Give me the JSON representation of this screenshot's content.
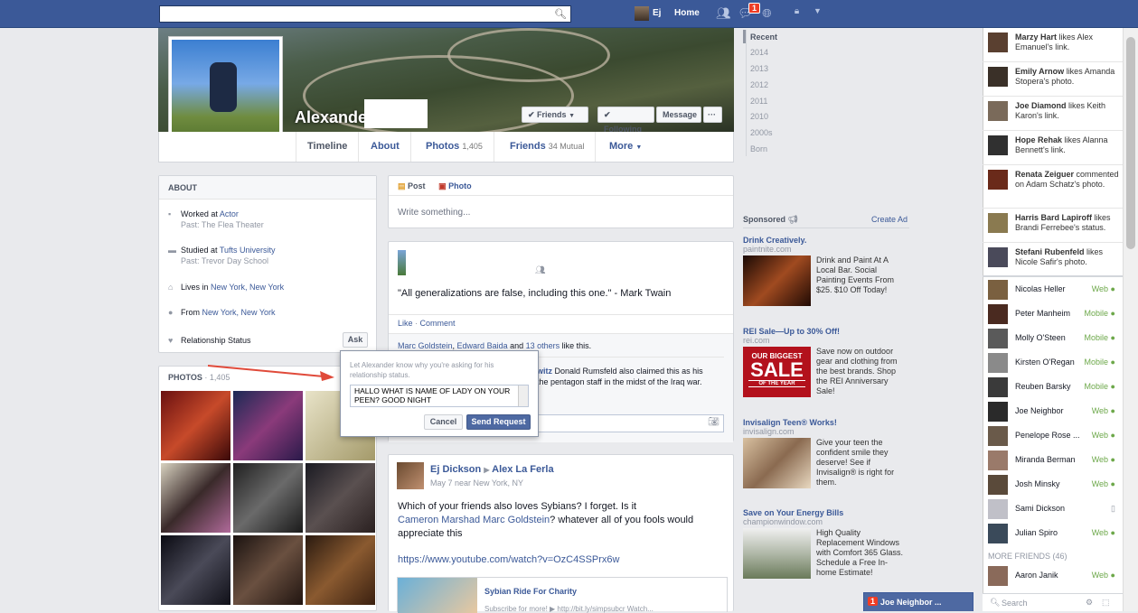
{
  "topbar": {
    "user_name": "Ej",
    "home_label": "Home",
    "notification_count": "1"
  },
  "profile": {
    "name": "Alexande",
    "friends_btn": "Friends",
    "following_btn": "Following",
    "message_btn": "Message",
    "more_btn": "···"
  },
  "tabs": {
    "timeline": "Timeline",
    "about": "About",
    "photos": "Photos",
    "photos_count": "1,405",
    "friends": "Friends",
    "friends_count": "34 Mutual",
    "more": "More"
  },
  "about": {
    "header": "ABOUT",
    "work_prefix": "Worked at ",
    "work_link": "Actor",
    "work_sub": "Past: The Flea Theater",
    "study_prefix": "Studied at ",
    "study_link": "Tufts University",
    "study_sub": "Past: Trevor Day School",
    "lives_prefix": "Lives in ",
    "lives_link": "New York, New York",
    "from_prefix": "From ",
    "from_link": "New York, New York",
    "relationship": "Relationship Status",
    "ask_btn": "Ask"
  },
  "photos_box": {
    "header": "PHOTOS",
    "count": "1,405"
  },
  "popup": {
    "prompt": "Let Alexander know why you're asking for his relationship status.",
    "text": "HALLO WHAT IS NAME OF LADY ON YOUR PEEN? GOOD NIGHT",
    "cancel": "Cancel",
    "send": "Send Request"
  },
  "composer": {
    "post_tab": "Post",
    "photo_tab": "Photo",
    "placeholder": "Write something..."
  },
  "post1": {
    "quote": "\"All generalizations are false, including this one.\" - Mark Twain",
    "like": "Like",
    "comment": "Comment",
    "likers_a": "Marc Goldstein",
    "likers_b": "Edward Baida",
    "likers_and": " and ",
    "likers_others": "13 others",
    "likers_suffix": " like this.",
    "comment_name": "witz",
    "comment_text": "Donald Rumsfeld also claimed this as his",
    "comment_text2": "the pentagon staff in the midst of the Iraq war."
  },
  "post2": {
    "author": "Ej Dickson",
    "target": "Alex La Ferla",
    "meta": "May 7 near New York, NY",
    "text1": "Which of your friends also loves Sybians? I forget. Is it",
    "name1": "Cameron Marshad",
    "name2": "Marc Goldstein",
    "text2": "? whatever all of you fools would",
    "text3": "appreciate this",
    "url": "https://www.youtube.com/watch?v=OzC4SSPrx6w",
    "link_title": "Sybian Ride For Charity",
    "link_sub": "Subscribe for more! ▶ http://bit.ly/simpsubcr Watch..."
  },
  "timeline_nav": [
    "Recent",
    "2014",
    "2013",
    "2012",
    "2011",
    "2010",
    "2000s",
    "Born"
  ],
  "sponsored": {
    "label": "Sponsored",
    "create_ad": "Create Ad",
    "ads": [
      {
        "title": "Drink Creatively.",
        "url": "paintnite.com",
        "desc": "Drink and Paint At A Local Bar. Social Painting Events From $25. $10 Off Today!"
      },
      {
        "title": "REI Sale—Up to 30% Off!",
        "url": "rei.com",
        "desc": "Save now on outdoor gear and clothing from the best brands. Shop the REI Anniversary Sale!",
        "img_text1": "OUR BIGGEST",
        "img_text2": "SALE",
        "img_text3": "OF THE YEAR"
      },
      {
        "title": "Invisalign Teen® Works!",
        "url": "invisalign.com",
        "desc": "Give your teen the confident smile they deserve! See if Invisalign® is right for them."
      },
      {
        "title": "Save on Your Energy Bills",
        "url": "championwindow.com",
        "desc": "High Quality Replacement Windows with Comfort 365 Glass. Schedule a Free In-home Estimate!"
      }
    ]
  },
  "ticker": [
    {
      "name": "Marzy Hart",
      "rest": " likes Alex Emanuel's link."
    },
    {
      "name": "Emily Arnow",
      "rest": " likes Amanda Stopera's photo."
    },
    {
      "name": "Joe Diamond",
      "rest": " likes Keith Karon's link."
    },
    {
      "name": "Hope Rehak",
      "rest": " likes Alanna Bennett's link."
    },
    {
      "name": "Renata Zeiguer",
      "rest": " commented on Adam Schatz's photo."
    },
    {
      "name": "Harris Bard Lapiroff",
      "rest": " likes Brandi Ferrebee's status."
    },
    {
      "name": "Stefani Rubenfeld",
      "rest": " likes Nicole Safir's photo."
    }
  ],
  "chat": [
    {
      "name": "Nicolas Heller",
      "status": "Web ●"
    },
    {
      "name": "Peter Manheim",
      "status": "Mobile ●"
    },
    {
      "name": "Molly O'Steen",
      "status": "Mobile ●"
    },
    {
      "name": "Kirsten O'Regan",
      "status": "Mobile ●"
    },
    {
      "name": "Reuben Barsky",
      "status": "Mobile ●"
    },
    {
      "name": "Joe Neighbor",
      "status": "Web ●"
    },
    {
      "name": "Penelope Rose ...",
      "status": "Web ●"
    },
    {
      "name": "Miranda Berman",
      "status": "Web ●"
    },
    {
      "name": "Josh Minsky",
      "status": "Web ●"
    },
    {
      "name": "Sami Dickson",
      "status": "▯"
    },
    {
      "name": "Julian Spiro",
      "status": "Web ●"
    }
  ],
  "more_friends": "MORE FRIENDS (46)",
  "chat_more": {
    "name": "Aaron Janik",
    "status": "Web ●"
  },
  "chat_search": "Search",
  "chat_tab": {
    "count": "1",
    "name": "Joe Neighbor ..."
  },
  "colors": {
    "brand": "#3b5998",
    "accent_button": "#4e69a2",
    "online": "#6da84a"
  }
}
